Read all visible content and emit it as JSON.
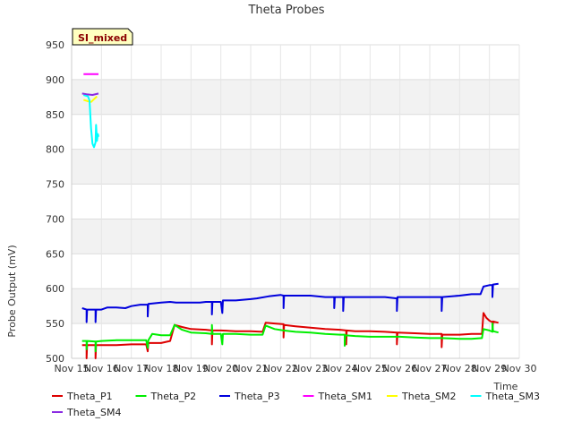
{
  "chart_data": {
    "type": "line",
    "title": "Theta Probes",
    "xlabel": "Time",
    "ylabel": "Probe Output (mV)",
    "badge": "SI_mixed",
    "ylim": [
      500,
      950
    ],
    "xlim": [
      15,
      30
    ],
    "yticks": [
      500,
      550,
      600,
      650,
      700,
      750,
      800,
      850,
      900,
      950
    ],
    "xticks": [
      {
        "v": 15,
        "label": "Nov 15"
      },
      {
        "v": 16,
        "label": "Nov 16"
      },
      {
        "v": 17,
        "label": "Nov 17"
      },
      {
        "v": 18,
        "label": "Nov 18"
      },
      {
        "v": 19,
        "label": "Nov 19"
      },
      {
        "v": 20,
        "label": "Nov 20"
      },
      {
        "v": 21,
        "label": "Nov 21"
      },
      {
        "v": 22,
        "label": "Nov 22"
      },
      {
        "v": 23,
        "label": "Nov 23"
      },
      {
        "v": 24,
        "label": "Nov 24"
      },
      {
        "v": 25,
        "label": "Nov 25"
      },
      {
        "v": 26,
        "label": "Nov 26"
      },
      {
        "v": 27,
        "label": "Nov 27"
      },
      {
        "v": 28,
        "label": "Nov 28"
      },
      {
        "v": 29,
        "label": "Nov 29"
      },
      {
        "v": 30,
        "label": "Nov 30"
      }
    ],
    "grid": true,
    "legend_position": "bottom",
    "series": [
      {
        "name": "Theta_P1",
        "color": "#dd0000",
        "points": [
          [
            15.35,
            519
          ],
          [
            15.5,
            519
          ],
          [
            15.5,
            500
          ],
          [
            15.52,
            519
          ],
          [
            15.8,
            519
          ],
          [
            15.8,
            500
          ],
          [
            15.82,
            519
          ],
          [
            16.5,
            519
          ],
          [
            17.0,
            520
          ],
          [
            17.5,
            520
          ],
          [
            17.55,
            510
          ],
          [
            17.57,
            522
          ],
          [
            18.0,
            522
          ],
          [
            18.3,
            525
          ],
          [
            18.45,
            548
          ],
          [
            18.7,
            545
          ],
          [
            19.0,
            542
          ],
          [
            19.5,
            541
          ],
          [
            19.7,
            540
          ],
          [
            19.7,
            520
          ],
          [
            19.72,
            540
          ],
          [
            20.0,
            540
          ],
          [
            20.5,
            539
          ],
          [
            21.0,
            539
          ],
          [
            21.4,
            538
          ],
          [
            21.5,
            551
          ],
          [
            21.8,
            550
          ],
          [
            22.1,
            549
          ],
          [
            22.1,
            530
          ],
          [
            22.12,
            548
          ],
          [
            22.5,
            546
          ],
          [
            23.0,
            544
          ],
          [
            23.5,
            542
          ],
          [
            24.0,
            541
          ],
          [
            24.2,
            540
          ],
          [
            24.2,
            520
          ],
          [
            24.22,
            540
          ],
          [
            24.5,
            539
          ],
          [
            25.0,
            539
          ],
          [
            25.5,
            538
          ],
          [
            25.9,
            537
          ],
          [
            25.9,
            520
          ],
          [
            25.92,
            537
          ],
          [
            26.5,
            536
          ],
          [
            27.0,
            535
          ],
          [
            27.4,
            535
          ],
          [
            27.4,
            516
          ],
          [
            27.42,
            534
          ],
          [
            28.0,
            534
          ],
          [
            28.4,
            535
          ],
          [
            28.75,
            535
          ],
          [
            28.8,
            565
          ],
          [
            28.9,
            558
          ],
          [
            29.0,
            554
          ],
          [
            29.1,
            552
          ],
          [
            29.1,
            540
          ],
          [
            29.12,
            553
          ],
          [
            29.3,
            551
          ]
        ]
      },
      {
        "name": "Theta_P2",
        "color": "#00ee00",
        "points": [
          [
            15.35,
            525
          ],
          [
            15.5,
            525
          ],
          [
            15.5,
            513
          ],
          [
            15.52,
            525
          ],
          [
            15.8,
            524
          ],
          [
            15.8,
            510
          ],
          [
            15.82,
            524
          ],
          [
            16.0,
            525
          ],
          [
            16.5,
            526
          ],
          [
            17.0,
            526
          ],
          [
            17.5,
            526
          ],
          [
            17.55,
            515
          ],
          [
            17.57,
            526
          ],
          [
            17.7,
            535
          ],
          [
            18.0,
            533
          ],
          [
            18.3,
            533
          ],
          [
            18.45,
            548
          ],
          [
            18.7,
            541
          ],
          [
            19.0,
            537
          ],
          [
            19.5,
            536
          ],
          [
            19.7,
            535
          ],
          [
            19.7,
            548
          ],
          [
            19.72,
            535
          ],
          [
            20.0,
            535
          ],
          [
            20.05,
            520
          ],
          [
            20.07,
            535
          ],
          [
            20.5,
            535
          ],
          [
            21.0,
            534
          ],
          [
            21.4,
            534
          ],
          [
            21.5,
            547
          ],
          [
            21.8,
            542
          ],
          [
            22.1,
            540
          ],
          [
            22.5,
            538
          ],
          [
            23.0,
            537
          ],
          [
            23.5,
            535
          ],
          [
            24.0,
            534
          ],
          [
            24.15,
            534
          ],
          [
            24.15,
            518
          ],
          [
            24.17,
            533
          ],
          [
            24.5,
            532
          ],
          [
            25.0,
            531
          ],
          [
            25.5,
            531
          ],
          [
            26.0,
            531
          ],
          [
            26.5,
            530
          ],
          [
            27.0,
            529
          ],
          [
            27.4,
            529
          ],
          [
            28.0,
            528
          ],
          [
            28.4,
            528
          ],
          [
            28.75,
            529
          ],
          [
            28.8,
            542
          ],
          [
            29.0,
            540
          ],
          [
            29.1,
            538
          ],
          [
            29.1,
            550
          ],
          [
            29.12,
            539
          ],
          [
            29.3,
            537
          ]
        ]
      },
      {
        "name": "Theta_P3",
        "color": "#0000dd",
        "points": [
          [
            15.35,
            572
          ],
          [
            15.5,
            570
          ],
          [
            15.5,
            552
          ],
          [
            15.52,
            570
          ],
          [
            15.8,
            570
          ],
          [
            15.8,
            552
          ],
          [
            15.82,
            570
          ],
          [
            16.0,
            570
          ],
          [
            16.2,
            573
          ],
          [
            16.5,
            573
          ],
          [
            16.8,
            572
          ],
          [
            17.0,
            575
          ],
          [
            17.3,
            577
          ],
          [
            17.55,
            577
          ],
          [
            17.55,
            560
          ],
          [
            17.57,
            578
          ],
          [
            18.0,
            580
          ],
          [
            18.3,
            581
          ],
          [
            18.5,
            580
          ],
          [
            19.0,
            580
          ],
          [
            19.3,
            580
          ],
          [
            19.5,
            581
          ],
          [
            19.7,
            581
          ],
          [
            19.7,
            563
          ],
          [
            19.72,
            581
          ],
          [
            20.0,
            581
          ],
          [
            20.05,
            565
          ],
          [
            20.07,
            583
          ],
          [
            20.5,
            583
          ],
          [
            21.0,
            585
          ],
          [
            21.2,
            586
          ],
          [
            21.6,
            589
          ],
          [
            22.0,
            591
          ],
          [
            22.1,
            590
          ],
          [
            22.1,
            572
          ],
          [
            22.12,
            590
          ],
          [
            22.5,
            590
          ],
          [
            23.0,
            590
          ],
          [
            23.5,
            588
          ],
          [
            23.8,
            588
          ],
          [
            23.8,
            572
          ],
          [
            23.82,
            588
          ],
          [
            24.1,
            588
          ],
          [
            24.1,
            568
          ],
          [
            24.12,
            588
          ],
          [
            24.5,
            588
          ],
          [
            25.0,
            588
          ],
          [
            25.5,
            588
          ],
          [
            25.9,
            586
          ],
          [
            25.9,
            568
          ],
          [
            25.92,
            588
          ],
          [
            26.5,
            588
          ],
          [
            27.0,
            588
          ],
          [
            27.4,
            588
          ],
          [
            27.4,
            568
          ],
          [
            27.42,
            588
          ],
          [
            28.0,
            590
          ],
          [
            28.4,
            592
          ],
          [
            28.7,
            592
          ],
          [
            28.8,
            603
          ],
          [
            29.0,
            605
          ],
          [
            29.1,
            605
          ],
          [
            29.1,
            588
          ],
          [
            29.12,
            606
          ],
          [
            29.3,
            607
          ]
        ]
      },
      {
        "name": "Theta_SM1",
        "color": "#ff00ff",
        "points": [
          [
            15.4,
            908
          ],
          [
            15.9,
            908
          ]
        ]
      },
      {
        "name": "Theta_SM2",
        "color": "#ffff00",
        "points": [
          [
            15.4,
            871
          ],
          [
            15.55,
            869
          ],
          [
            15.65,
            868
          ],
          [
            15.75,
            872
          ],
          [
            15.85,
            876
          ]
        ]
      },
      {
        "name": "Theta_SM3",
        "color": "#00ffff",
        "points": [
          [
            15.4,
            878
          ],
          [
            15.55,
            876
          ],
          [
            15.6,
            870
          ],
          [
            15.65,
            830
          ],
          [
            15.7,
            808
          ],
          [
            15.75,
            803
          ],
          [
            15.8,
            810
          ],
          [
            15.82,
            835
          ],
          [
            15.85,
            812
          ],
          [
            15.88,
            822
          ],
          [
            15.9,
            818
          ]
        ]
      },
      {
        "name": "Theta_SM4",
        "color": "#8a2be2",
        "points": [
          [
            15.35,
            880
          ],
          [
            15.5,
            879
          ],
          [
            15.7,
            878
          ],
          [
            15.9,
            880
          ]
        ]
      }
    ]
  }
}
